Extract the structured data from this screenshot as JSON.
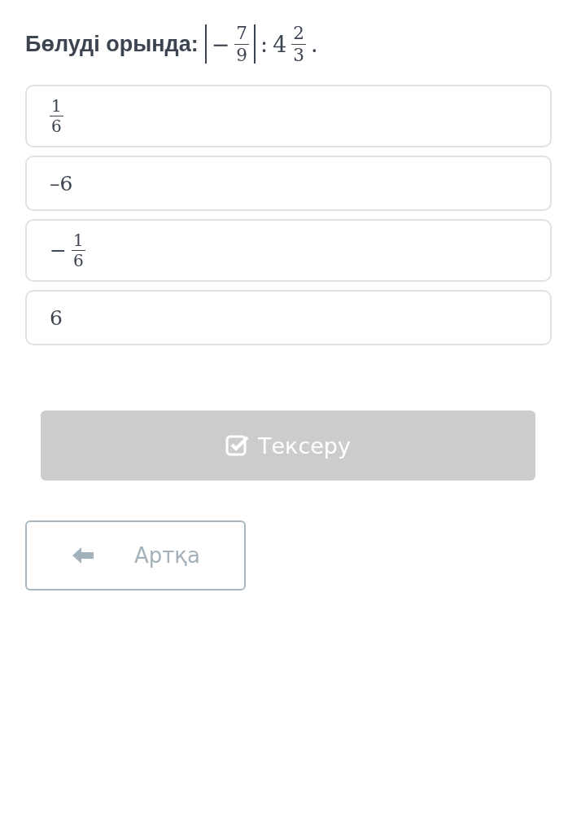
{
  "question": {
    "prompt": "Бөлуді орында:",
    "expression": [
      {
        "kind": "bar"
      },
      {
        "kind": "text",
        "text": "−"
      },
      {
        "kind": "frac",
        "numerator": "7",
        "denominator": "9"
      },
      {
        "kind": "bar"
      },
      {
        "kind": "text",
        "text": ":"
      },
      {
        "kind": "text",
        "text": "4"
      },
      {
        "kind": "frac",
        "numerator": "2",
        "denominator": "3"
      },
      {
        "kind": "text",
        "text": "."
      }
    ]
  },
  "options": [
    {
      "selected": false,
      "parts": [
        {
          "kind": "frac",
          "numerator": "1",
          "denominator": "6"
        }
      ]
    },
    {
      "selected": false,
      "parts": [
        {
          "kind": "text",
          "text": "–6"
        }
      ]
    },
    {
      "selected": false,
      "parts": [
        {
          "kind": "text",
          "text": "−"
        },
        {
          "kind": "frac",
          "numerator": "1",
          "denominator": "6"
        }
      ]
    },
    {
      "selected": false,
      "parts": [
        {
          "kind": "text",
          "text": "6"
        }
      ]
    }
  ],
  "check_button": {
    "label": "Тексеру",
    "disabled": true
  },
  "back_button": {
    "label": "Артқа"
  }
}
